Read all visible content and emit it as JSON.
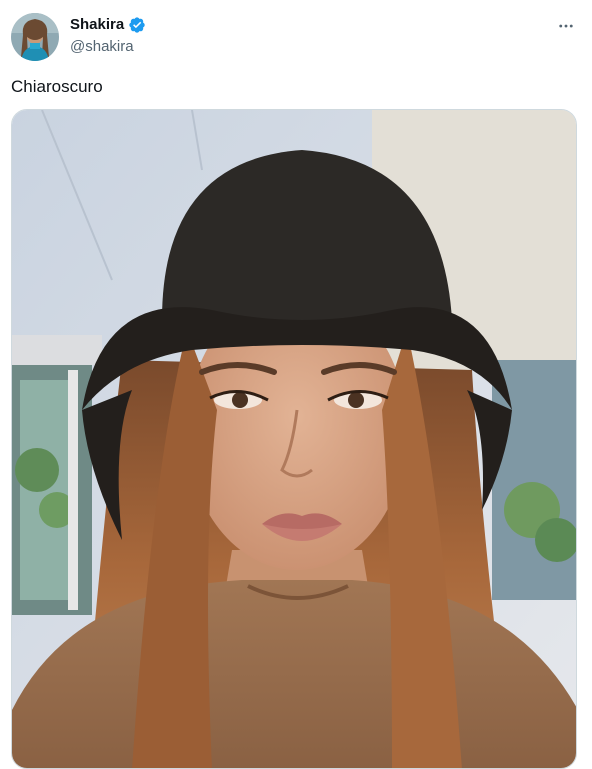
{
  "author": {
    "display_name": "Shakira",
    "handle": "@shakira",
    "verified": true,
    "verified_color": "#1d9bf0"
  },
  "tweet": {
    "text": "Chiaroscuro"
  },
  "icons": {
    "verified": "verified-badge-icon",
    "more": "more-horizontal-icon"
  },
  "colors": {
    "text_primary": "#0f1419",
    "text_secondary": "#536471",
    "border": "#cfd9de"
  }
}
